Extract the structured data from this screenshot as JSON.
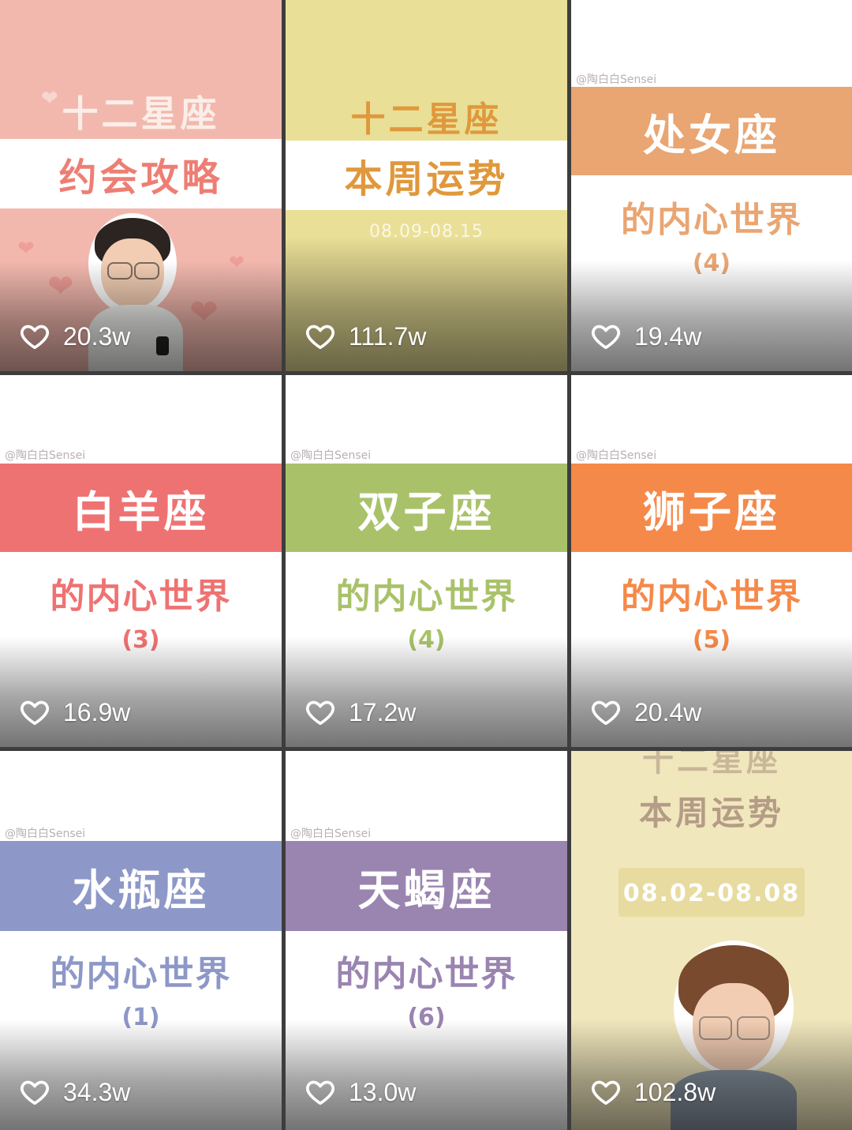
{
  "tiles": [
    {
      "top_line": "十二星座",
      "band": "约会攻略",
      "likes": "20.3w"
    },
    {
      "top_line": "十二星座",
      "band": "本周运势",
      "date": "08.09-08.15",
      "likes": "111.7w"
    },
    {
      "watermark": "@陶白白Sensei",
      "band": "处女座",
      "subtitle": "的内心世界",
      "part": "(4)",
      "likes": "19.4w"
    },
    {
      "watermark": "@陶白白Sensei",
      "band": "白羊座",
      "subtitle": "的内心世界",
      "part": "(3)",
      "likes": "16.9w"
    },
    {
      "watermark": "@陶白白Sensei",
      "band": "双子座",
      "subtitle": "的内心世界",
      "part": "(4)",
      "likes": "17.2w"
    },
    {
      "watermark": "@陶白白Sensei",
      "band": "狮子座",
      "subtitle": "的内心世界",
      "part": "(5)",
      "likes": "20.4w"
    },
    {
      "watermark": "@陶白白Sensei",
      "band": "水瓶座",
      "subtitle": "的内心世界",
      "part": "(1)",
      "likes": "34.3w"
    },
    {
      "watermark": "@陶白白Sensei",
      "band": "天蝎座",
      "subtitle": "的内心世界",
      "part": "(6)",
      "likes": "13.0w"
    },
    {
      "top_line": "十二星座",
      "band": "本周运势",
      "date": "08.02-08.08",
      "likes": "102.8w"
    }
  ],
  "colors": {
    "pink": "#f2b8ae",
    "pink_text": "#ee7e74",
    "yellow": "#e9df97",
    "yellow_text": "#e0983c",
    "orange_band": "#e9a572",
    "coral": "#ef7272",
    "green": "#a9c26a",
    "bright_orange": "#f5894a",
    "blue": "#8d98c8",
    "purple": "#9a84b0",
    "cream": "#f1e7bd"
  },
  "icons": {
    "like": "heart-outline-icon"
  }
}
